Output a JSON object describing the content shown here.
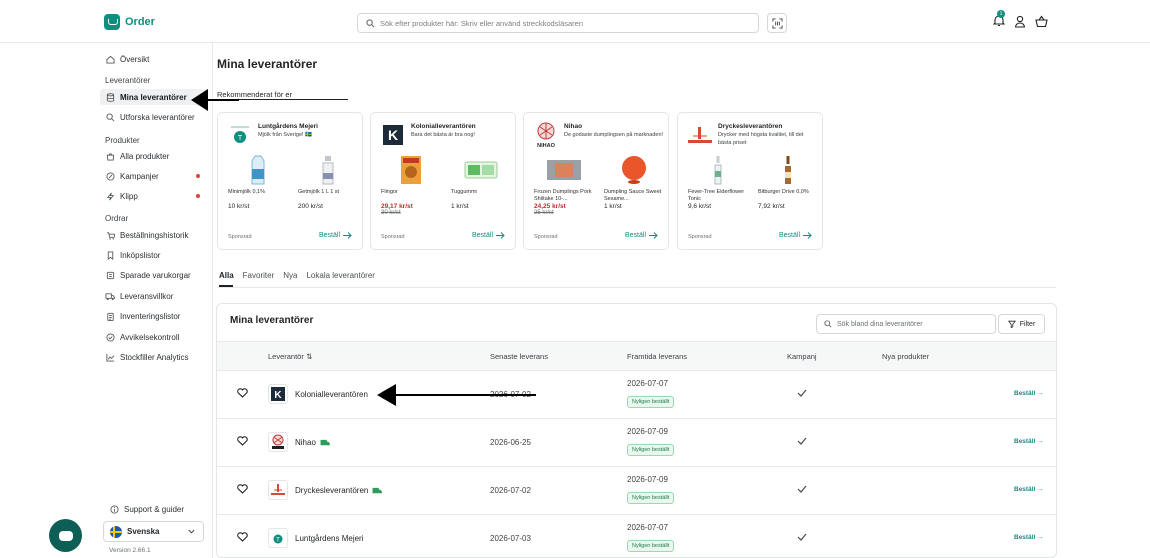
{
  "app": {
    "name": "Order"
  },
  "header": {
    "search_placeholder": "Sök efter produkter här: Skriv eller använd streckkodsläsaren",
    "notification_count": "1"
  },
  "sidebar": {
    "overview": "Översikt",
    "sections": {
      "suppliers": "Leverantörer",
      "products": "Produkter",
      "orders": "Ordrar"
    },
    "items": {
      "my_suppliers": "Mina leverantörer",
      "explore_suppliers": "Utforska leverantörer",
      "all_products": "Alla produkter",
      "campaigns": "Kampanjer",
      "clips": "Klipp",
      "order_history": "Beställningshistorik",
      "shopping_lists": "Inköpslistor",
      "saved_carts": "Sparade varukorgar",
      "delivery_terms": "Leveransvillkor",
      "inventory_lists": "Inventeringslistor",
      "deviation_control": "Avvikelsekontroll",
      "analytics": "Stockfiller Analytics"
    },
    "support": "Support & guider",
    "language": "Svenska",
    "version": "Version 2.66.1"
  },
  "page": {
    "title": "Mina leverantörer",
    "recommended_title": "Rekommenderat för er"
  },
  "recommended": [
    {
      "name": "Luntgårdens Mejeri",
      "description": "Mjölk från Sverige! 🇸🇪",
      "products": [
        {
          "name": "Minimjölk 0,1%",
          "price": "10 kr/st"
        },
        {
          "name": "Getmjölk 1 L 1 st",
          "price": "200 kr/st"
        }
      ],
      "sponsored": "Sponsrad",
      "order": "Beställ"
    },
    {
      "name": "Kolonialleverantören",
      "description": "Bara det bästa är bra nog!",
      "products": [
        {
          "name": "Flingor",
          "price": "29,17 kr/st",
          "old_price": "30 kr/st"
        },
        {
          "name": "Tuggummi",
          "price": "1 kr/st"
        }
      ],
      "sponsored": "Sponsrad",
      "order": "Beställ"
    },
    {
      "name": "Nihao",
      "description": "De godaste dumplingsen på marknaden!",
      "products": [
        {
          "name": "Frozen Dumplings Pork Shiitake 10-...",
          "price": "24,25 kr/st",
          "old_price": "25 kr/st"
        },
        {
          "name": "Dumpling Sauce Sweet Sesame...",
          "price": "1 kr/st"
        }
      ],
      "sponsored": "Sponsrad",
      "order": "Beställ"
    },
    {
      "name": "Dryckesleverantören",
      "description": "Drycker med högsta kvalitet, till det bästa priset",
      "products": [
        {
          "name": "Fever-Tree Elderflower Tonic",
          "price": "9,6 kr/st"
        },
        {
          "name": "Bitburger Drive 0,0%",
          "price": "7,92 kr/st"
        }
      ],
      "sponsored": "Sponsrad",
      "order": "Beställ"
    }
  ],
  "tabs": [
    "Alla",
    "Favoriter",
    "Nya",
    "Lokala leverantörer"
  ],
  "supplier_list": {
    "title": "Mina leverantörer",
    "search_placeholder": "Sök bland dina leverantörer",
    "filter_label": "Filter",
    "columns": {
      "supplier": "Leverantör ⇅",
      "last_delivery": "Senaste leverans",
      "future_delivery": "Framtida leverans",
      "campaign": "Kampanj",
      "new_products": "Nya produkter"
    },
    "rows": [
      {
        "name": "Kolonialleverantören",
        "last": "2026-07-02",
        "future": "2026-07-07",
        "badge": "Nyligen beställt",
        "order": "Beställ →"
      },
      {
        "name": "Nihao",
        "last": "2026-06-25",
        "future": "2026-07-09",
        "badge": "Nyligen beställt",
        "order": "Beställ →"
      },
      {
        "name": "Dryckesleverantören",
        "last": "2026-07-02",
        "future": "2026-07-09",
        "badge": "Nyligen beställt",
        "order": "Beställ →"
      },
      {
        "name": "Luntgårdens Mejeri",
        "last": "2026-07-03",
        "future": "2026-07-07",
        "badge": "Nyligen beställt",
        "order": "Beställ →"
      }
    ]
  },
  "colors": {
    "brand": "#0e8f7f",
    "sale": "#c4282d",
    "badge_bg": "#eaf7ef",
    "badge_text": "#1d7a4c"
  }
}
